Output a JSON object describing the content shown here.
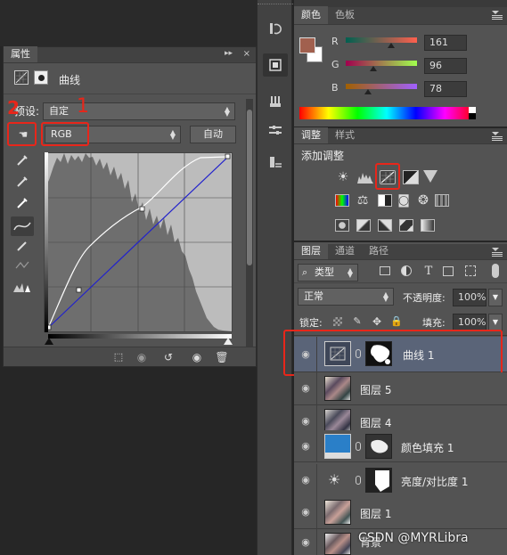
{
  "properties": {
    "tab": "属性",
    "adjustment_title": "曲线",
    "preset_label": "预设:",
    "preset_value": "自定",
    "channel_value": "RGB",
    "auto_label": "自动",
    "annot_1": "1",
    "annot_2": "2"
  },
  "color_panel": {
    "tabs": [
      "颜色",
      "色板"
    ],
    "channels": [
      {
        "label": "R",
        "value": "161",
        "fraction": 0.63
      },
      {
        "label": "G",
        "value": "96",
        "fraction": 0.38
      },
      {
        "label": "B",
        "value": "78",
        "fraction": 0.31
      }
    ],
    "foreground": "#a1604e",
    "background": "#ffffff"
  },
  "adjustments_panel": {
    "tabs": [
      "调整",
      "样式"
    ],
    "add_label": "添加调整"
  },
  "layers_panel": {
    "tabs": [
      "图层",
      "通道",
      "路径"
    ],
    "filter_value": "类型",
    "blend_mode": "正常",
    "opacity_label": "不透明度:",
    "opacity_value": "100%",
    "lock_label": "锁定:",
    "fill_label": "填充:",
    "fill_value": "100%",
    "layers": [
      {
        "name": "曲线 1",
        "type": "curves-adjustment",
        "selected": true
      },
      {
        "name": "图层 5",
        "type": "pixel"
      },
      {
        "name": "图层 4",
        "type": "pixel"
      },
      {
        "name": "颜色填充 1",
        "type": "solid-color-fill"
      },
      {
        "name": "亮度/对比度 1",
        "type": "brightness-contrast-adjustment"
      },
      {
        "name": "图层 1",
        "type": "pixel"
      },
      {
        "name": "背景",
        "type": "pixel"
      }
    ]
  },
  "watermark": "CSDN @MYRLibra"
}
